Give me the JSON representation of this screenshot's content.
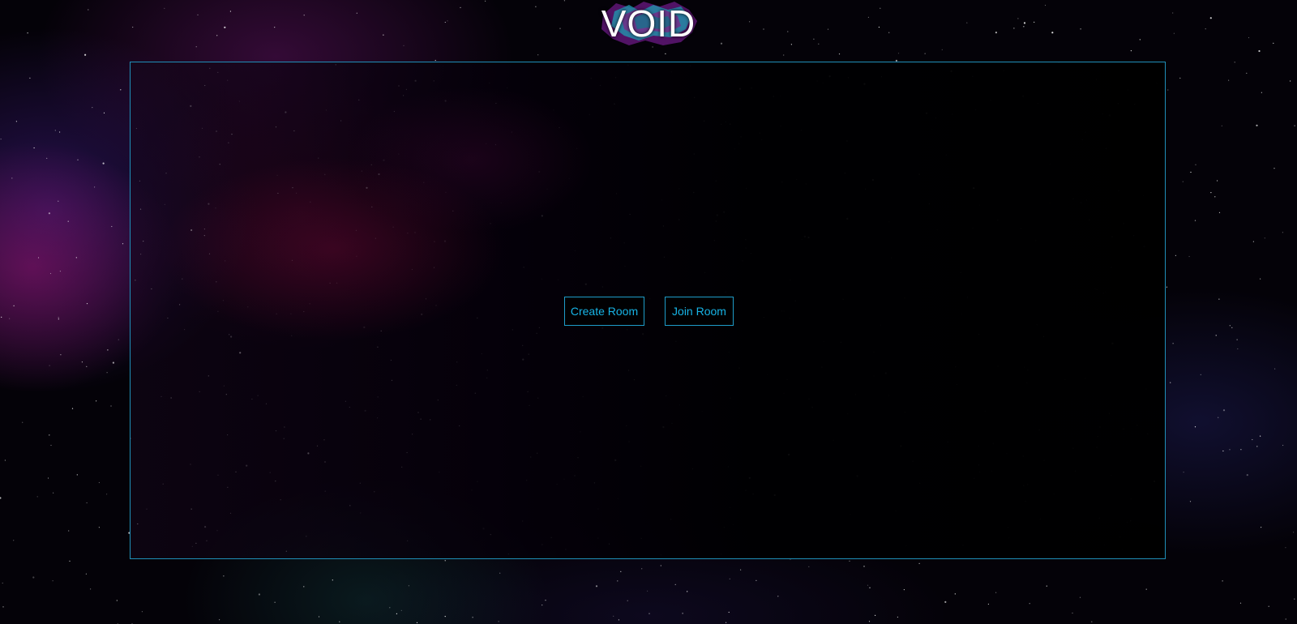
{
  "app": {
    "logo_text": "VOID"
  },
  "main": {
    "create_room_label": "Create Room",
    "join_room_label": "Join Room"
  },
  "colors": {
    "accent": "#1e9cc9",
    "button_text": "#17b4e6",
    "background": "#040208"
  },
  "icons": {
    "logo_splash": "paint-splash-icon"
  }
}
